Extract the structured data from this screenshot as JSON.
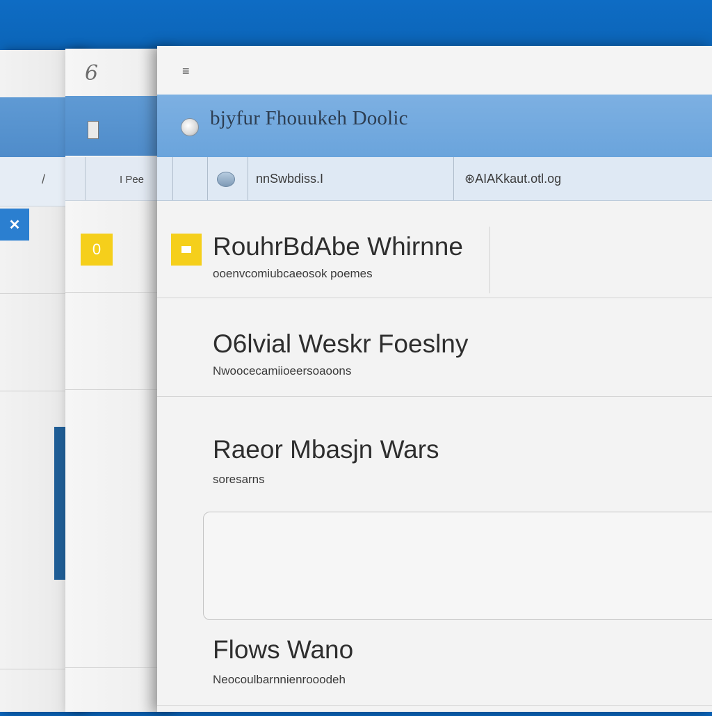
{
  "back_window": {
    "tile_glyph": "✕",
    "strip_mark": "/"
  },
  "middle_window": {
    "title_glyph": "6",
    "strip_label": "I Pee",
    "tile_glyph": "0"
  },
  "front_window": {
    "title_glyph": "≡",
    "header_title": "bjyfur Fhouukeh Doolic",
    "toolbar": {
      "field_text": "nnSwbdiss.I",
      "url_text": "⊛AIAKkaut.otl.og"
    },
    "items": [
      {
        "title": "RouhrBdAbe Whirnne",
        "subtitle": "ooenvcomiubcaeosok poemes"
      },
      {
        "title": "O6lvial Weskr Foeslny",
        "subtitle": "Nwoocecamiioeersoaoons"
      },
      {
        "title": "Raeor Mbasjn Wars",
        "subtitle": "soresarns"
      },
      {
        "title": "Flows Wano",
        "subtitle": "Neocoulbarnnienrooodeh"
      }
    ]
  },
  "colors": {
    "desktop_blue": "#0b63b5",
    "header_blue": "#6aa4dc",
    "toolbar_blue": "#dfe9f4",
    "tile_yellow": "#f5cf1b",
    "window_bg": "#f3f3f3"
  },
  "icons": [
    "app-icon",
    "avatar-icon",
    "search-icon",
    "yellow-tile-icon",
    "doc-icon"
  ]
}
